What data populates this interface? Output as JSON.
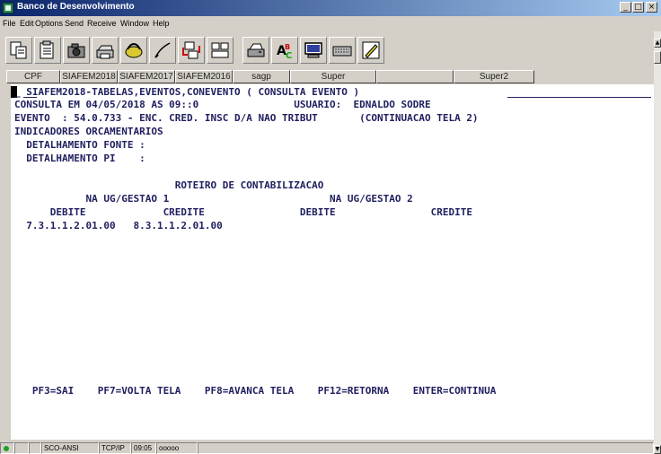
{
  "window": {
    "title": "Banco de Desenvolvimento",
    "controls": {
      "minimize": "_",
      "restore": "□",
      "close": "×"
    }
  },
  "menu": [
    "File",
    "Edit",
    "Options",
    "Send",
    "Receive",
    "Window",
    "Help"
  ],
  "toolbar": {
    "icons": [
      "copy-screen-icon",
      "paste-icon",
      "camera-icon",
      "print-icon",
      "connect-icon",
      "pen-icon",
      "transfer-icon",
      "layout-icon",
      "printer-icon",
      "spellcheck-icon",
      "monitor-icon",
      "keyboard-icon",
      "screen-edit-icon"
    ]
  },
  "keys": [
    "CPF",
    "SIAFEM2018",
    "SIAFEM2017",
    "SIAFEM2016",
    "sagp",
    "Super",
    "",
    "Super2"
  ],
  "terminal": {
    "lines": [
      "_ SIAFEM2018-TABELAS,EVENTOS,CONEVENTO ( CONSULTA EVENTO ) ",
      "CONSULTA EM 04/05/2018 AS 09::0                USUARIO:  EDNALDO SODRE",
      "EVENTO  : 54.0.733 - ENC. CRED. INSC D/A NAO TRIBUT       (CONTINUACAO TELA 2)",
      "INDICADORES ORCAMENTARIOS",
      "  DETALHAMENTO FONTE :",
      "  DETALHAMENTO PI    :",
      "",
      "                           ROTEIRO DE CONTABILIZACAO",
      "            NA UG/GESTAO 1                           NA UG/GESTAO 2",
      "      DEBITE             CREDITE                DEBITE                CREDITE",
      "  7.3.1.1.2.01.00   8.3.1.1.2.01.00",
      "",
      "",
      "",
      "",
      "",
      "",
      "",
      "",
      "",
      "",
      "",
      "   PF3=SAI    PF7=VOLTA TELA    PF8=AVANCA TELA    PF12=RETORNA    ENTER=CONTINUA"
    ]
  },
  "status": {
    "cells": [
      "",
      "",
      "",
      "SCO-ANSI",
      "TCP/IP",
      "09:05",
      "ooooo"
    ]
  },
  "colors": {
    "title_start": "#0a246a",
    "title_end": "#a6caf0",
    "terminal_text": "#202060",
    "status_ok": "#1fa01f"
  }
}
